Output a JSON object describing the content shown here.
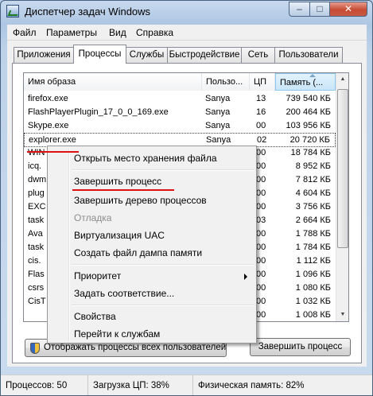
{
  "window": {
    "title": "Диспетчер задач Windows",
    "buttons": {
      "minimize": "–",
      "maximize": "□",
      "close": "✕"
    }
  },
  "menu": [
    "Файл",
    "Параметры",
    "Вид",
    "Справка"
  ],
  "tabs": [
    "Приложения",
    "Процессы",
    "Службы",
    "Быстродействие",
    "Сеть",
    "Пользователи"
  ],
  "active_tab": "Процессы",
  "table": {
    "columns": [
      "Имя образа",
      "Пользо...",
      "ЦП",
      "Память (..."
    ],
    "rows": [
      [
        "firefox.exe",
        "Sanya",
        "13",
        "739 540 КБ"
      ],
      [
        "FlashPlayerPlugin_17_0_0_169.exe",
        "Sanya",
        "16",
        "200 464 КБ"
      ],
      [
        "Skype.exe",
        "Sanya",
        "00",
        "103 956 КБ"
      ],
      [
        "explorer.exe",
        "Sanya",
        "02",
        "20 720 КБ"
      ],
      [
        "WIN",
        "",
        "00",
        "18 784 КБ"
      ],
      [
        "icq.",
        "",
        "00",
        "8 952 КБ"
      ],
      [
        "dwm",
        "",
        "00",
        "7 812 КБ"
      ],
      [
        "plug",
        "",
        "00",
        "4 604 КБ"
      ],
      [
        "EXC",
        "",
        "00",
        "3 756 КБ"
      ],
      [
        "task",
        "",
        "03",
        "2 664 КБ"
      ],
      [
        "Ava",
        "",
        "00",
        "1 788 КБ"
      ],
      [
        "task",
        "",
        "00",
        "1 784 КБ"
      ],
      [
        "cis.",
        "",
        "00",
        "1 112 КБ"
      ],
      [
        "Flas",
        "",
        "00",
        "1 096 КБ"
      ],
      [
        "csrs",
        "",
        "00",
        "1 080 КБ"
      ],
      [
        "CisT",
        "",
        "00",
        "1 032 КБ"
      ],
      [
        "",
        "",
        "00",
        "1 008 КБ"
      ]
    ]
  },
  "context_menu": {
    "items": [
      "Открыть место хранения файла",
      "Завершить процесс",
      "Завершить дерево процессов",
      "Отладка",
      "Виртуализация UAC",
      "Создать файл дампа памяти",
      "Приоритет",
      "Задать соответствие...",
      "Свойства",
      "Перейти к службам"
    ]
  },
  "buttons": {
    "show_all": "Отображать процессы всех пользователей",
    "end_process": "Завершить процесс"
  },
  "status": {
    "processes": "Процессов: 50",
    "cpu": "Загрузка ЦП: 38%",
    "memory": "Физическая память: 82%"
  },
  "icons": [
    "task-manager-icon",
    "shield-icon",
    "submenu-arrow-icon"
  ],
  "colors": {
    "annotation_underline": "#d11111",
    "close_button": "#c74b35"
  }
}
